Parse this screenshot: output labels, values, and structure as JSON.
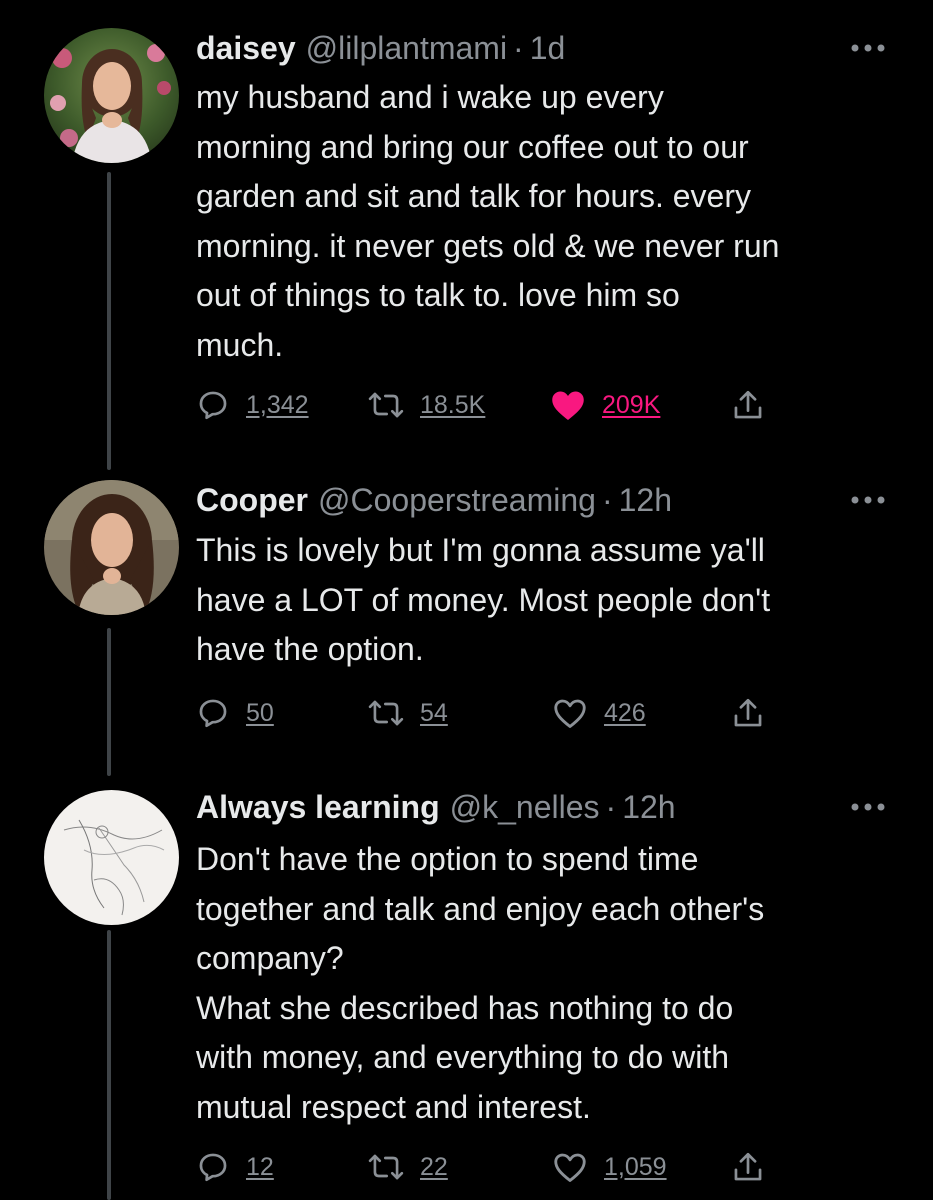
{
  "tweets": [
    {
      "name": "daisey",
      "handle": "@lilplantmami",
      "separator": "·",
      "time": "1d",
      "text": "my husband and i wake up every\nmorning and bring our coffee out to our\ngarden and sit and talk for hours. every\nmorning. it never gets old & we never run\nout of things to talk to. love him so\nmuch.",
      "replies": "1,342",
      "retweets": "18.5K",
      "likes": "209K",
      "liked": true,
      "avatar": "avatar-photo-woman-garden"
    },
    {
      "name": "Cooper",
      "handle": "@Cooperstreaming",
      "separator": "·",
      "time": "12h",
      "text": "This is lovely but I'm gonna assume ya'll\nhave a LOT of money. Most people don't\nhave the option.",
      "replies": "50",
      "retweets": "54",
      "likes": "426",
      "liked": false,
      "avatar": "avatar-photo-woman-brown-hair"
    },
    {
      "name": "Always learning",
      "handle": "@k_nelles",
      "separator": "·",
      "time": "12h",
      "text": "Don't have the option to spend time\ntogether and talk and enjoy each other's\ncompany?\nWhat she described has nothing to do\nwith money, and everything to do with\nmutual respect and interest.",
      "replies": "12",
      "retweets": "22",
      "likes": "1,059",
      "liked": false,
      "avatar": "avatar-sketch-drawing"
    }
  ],
  "icons": {
    "reply": "reply-icon",
    "retweet": "retweet-icon",
    "like": "heart-icon",
    "share": "share-icon",
    "more": "more-icon"
  },
  "colors": {
    "background": "#000000",
    "text": "#e7e9ea",
    "secondary": "#8b9096",
    "like_active": "#f91880",
    "thread_line": "#3f4448"
  }
}
